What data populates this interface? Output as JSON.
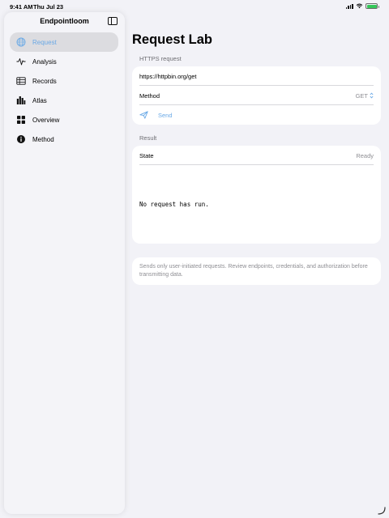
{
  "status": {
    "time": "9:41 AM",
    "date": "Thu Jul 23"
  },
  "sidebar": {
    "title": "Endpointloom",
    "items": [
      {
        "label": "Request",
        "icon": "globe-icon",
        "active": true
      },
      {
        "label": "Analysis",
        "icon": "waveform-icon",
        "active": false
      },
      {
        "label": "Records",
        "icon": "table-icon",
        "active": false
      },
      {
        "label": "Atlas",
        "icon": "bar-chart-icon",
        "active": false
      },
      {
        "label": "Overview",
        "icon": "grid-icon",
        "active": false
      },
      {
        "label": "Method",
        "icon": "info-icon",
        "active": false
      }
    ]
  },
  "main": {
    "title": "Request Lab",
    "request": {
      "header": "HTTPS request",
      "url": "https://httpbin.org/get",
      "method_label": "Method",
      "method_value": "GET",
      "send_label": "Send"
    },
    "result": {
      "header": "Result",
      "state_label": "State",
      "state_value": "Ready",
      "body": "No request has run."
    },
    "footer_note": "Sends only user-initiated requests. Review endpoints, credentials, and authorization before transmitting data."
  },
  "colors": {
    "accent": "#6aa9e6",
    "background": "#f2f2f7",
    "selected_row": "#dcdce0",
    "battery": "#34c759"
  }
}
